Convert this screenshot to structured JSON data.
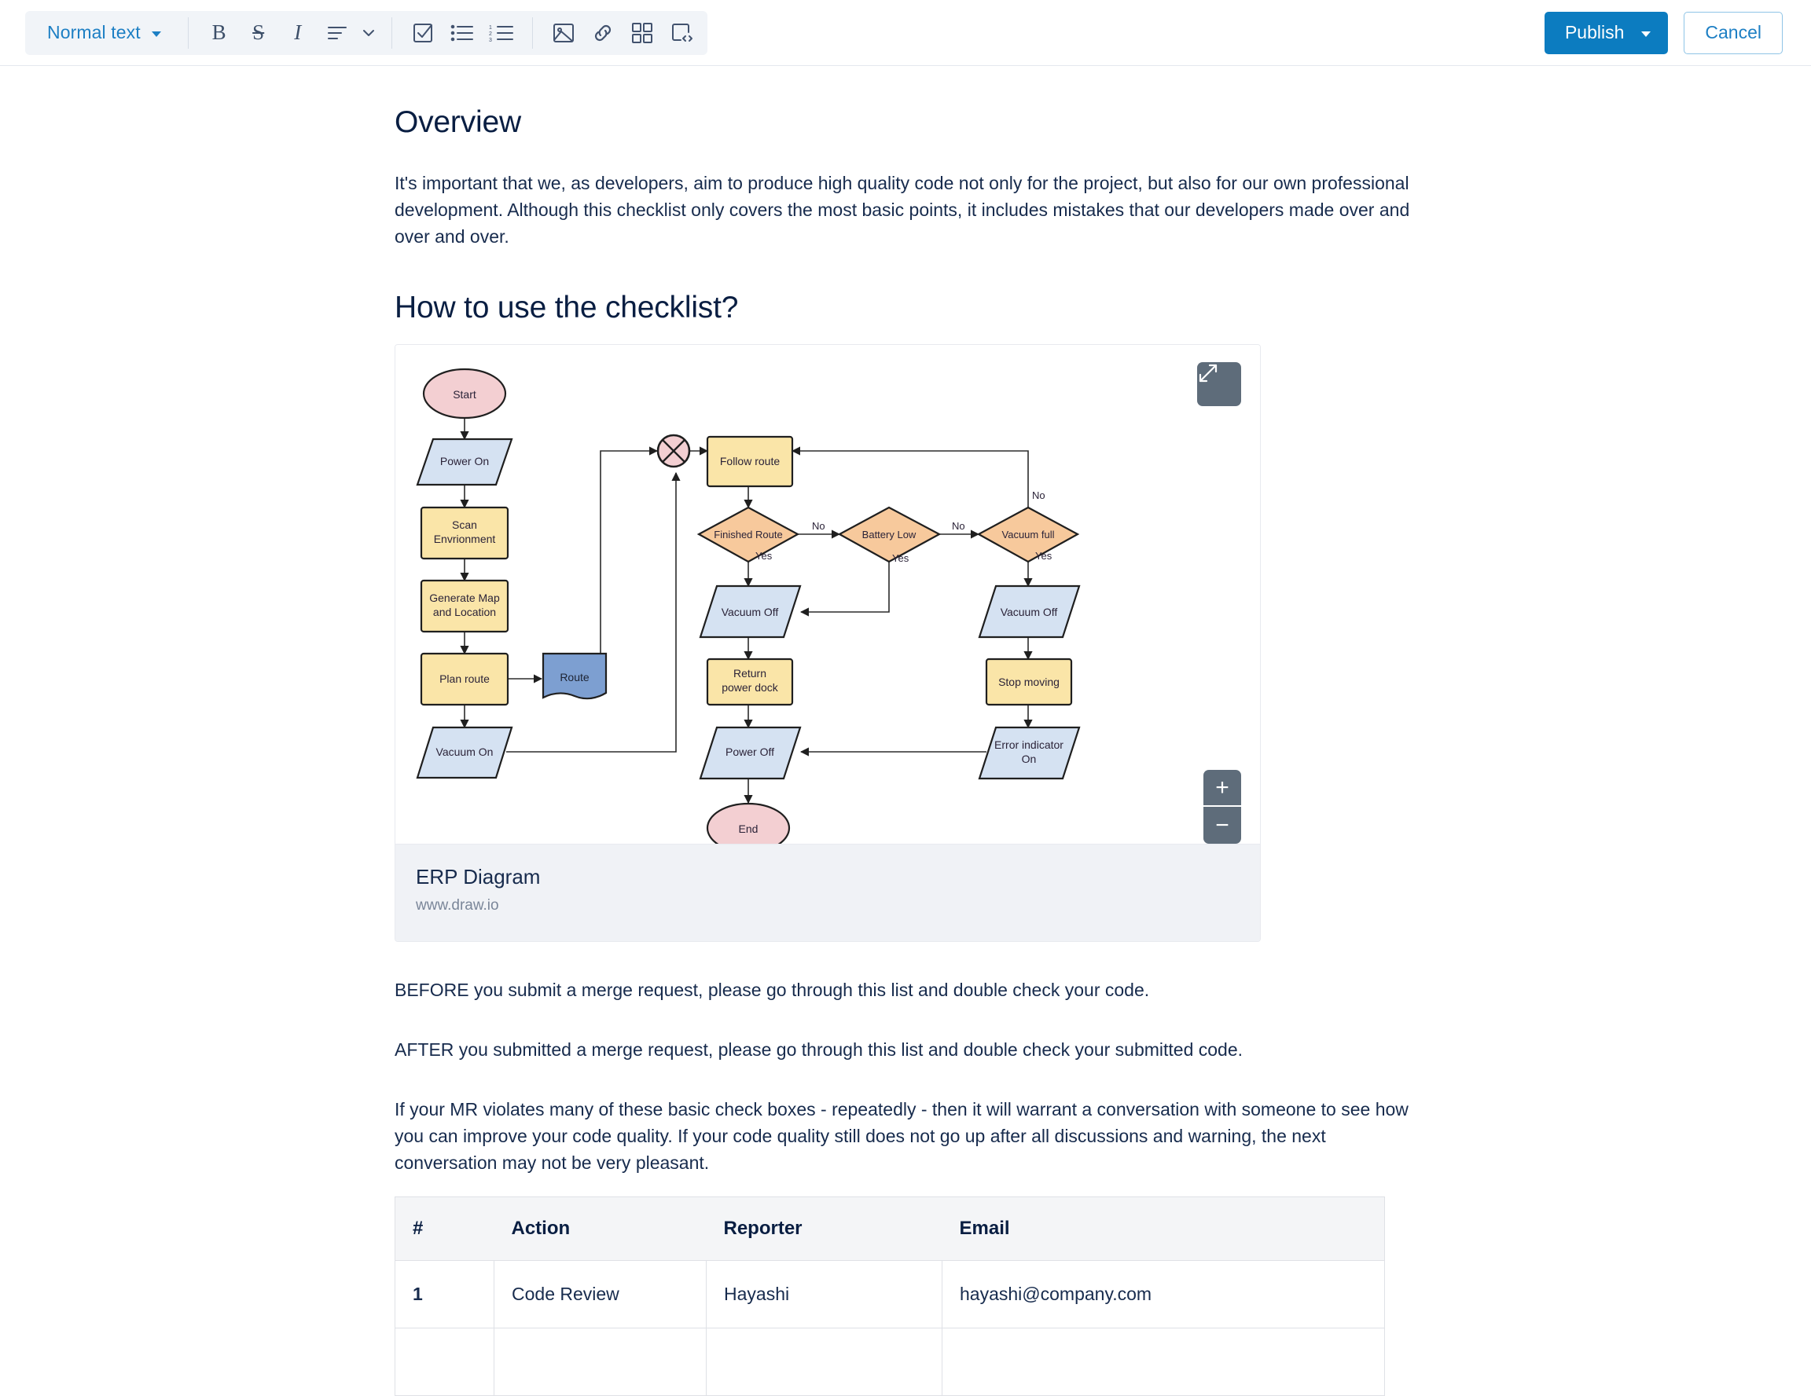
{
  "toolbar": {
    "style_selector": {
      "label": "Normal text",
      "icon": "chevron-down-icon"
    },
    "format_buttons": [
      {
        "name": "bold-button",
        "glyph": "B"
      },
      {
        "name": "strikethrough-button",
        "glyph": "S"
      },
      {
        "name": "italic-button",
        "glyph": "I"
      }
    ],
    "align_button": "align-left-icon",
    "align_chevron": "chevron-down-icon",
    "list_buttons": [
      "task-list-icon",
      "bullet-list-icon",
      "numbered-list-icon"
    ],
    "insert_buttons": [
      "image-icon",
      "link-icon",
      "table-icon",
      "code-block-icon"
    ],
    "publish_label": "Publish",
    "publish_chevron": "chevron-down-icon",
    "cancel_label": "Cancel"
  },
  "document": {
    "heading_overview": "Overview",
    "paragraph_overview": "It's important that we, as developers, aim to produce high quality code not only for the project, but also for our own professional development. Although this checklist only covers the most basic points, it includes mistakes that our developers made over and over and over.",
    "heading_howto": "How to use the checklist?",
    "paragraph_before": "BEFORE you submit a merge request, please go through this list and double check your code.",
    "paragraph_after": "AFTER you submitted a merge request, please go through this list and double check your submitted code.",
    "paragraph_violates": "If your MR violates many of these basic check boxes - repeatedly - then it will warrant a conversation with someone to see how you can improve your code quality. If your code quality still does not go up after all discussions and warning, the next conversation may not be very pleasant."
  },
  "diagram": {
    "caption_title": "ERP Diagram",
    "caption_subtitle": "www.draw.io",
    "expand_icon": "expand-icon",
    "zoom_in_label": "+",
    "zoom_out_label": "−",
    "colors": {
      "terminator_fill": "#f3cfd2",
      "io_fill": "#d5e2f2",
      "process_fill": "#fae5a8",
      "decision_fill": "#f7c99c",
      "document_fill": "#7d9fd1",
      "stroke": "#1f1f1f"
    },
    "nodes": [
      {
        "id": "start",
        "label": "Start",
        "shape": "ellipse"
      },
      {
        "id": "power-on",
        "label": "Power On",
        "shape": "parallelogram"
      },
      {
        "id": "scan",
        "label_line1": "Scan",
        "label_line2": "Envrionment",
        "shape": "process"
      },
      {
        "id": "genmap",
        "label_line1": "Generate Map",
        "label_line2": "and Location",
        "shape": "process"
      },
      {
        "id": "planroute",
        "label": "Plan route",
        "shape": "process"
      },
      {
        "id": "route",
        "label": "Route",
        "shape": "document"
      },
      {
        "id": "vacuum-on",
        "label": "Vacuum On",
        "shape": "parallelogram"
      },
      {
        "id": "merge",
        "label": "",
        "shape": "summing-junction"
      },
      {
        "id": "follow",
        "label": "Follow route",
        "shape": "process"
      },
      {
        "id": "finished",
        "label": "Finished Route",
        "shape": "decision"
      },
      {
        "id": "battery",
        "label": "Battery Low",
        "shape": "decision"
      },
      {
        "id": "vacfull",
        "label": "Vacuum full",
        "shape": "decision"
      },
      {
        "id": "vacoff1",
        "label": "Vacuum Off",
        "shape": "parallelogram"
      },
      {
        "id": "vacoff2",
        "label": "Vacuum Off",
        "shape": "parallelogram"
      },
      {
        "id": "returndock",
        "label_line1": "Return",
        "label_line2": "power dock",
        "shape": "process"
      },
      {
        "id": "stopmoving",
        "label": "Stop moving",
        "shape": "process"
      },
      {
        "id": "poweroff",
        "label": "Power Off",
        "shape": "parallelogram"
      },
      {
        "id": "errorind",
        "label_line1": "Error indicator",
        "label_line2": "On",
        "shape": "parallelogram"
      },
      {
        "id": "end",
        "label": "End",
        "shape": "ellipse"
      }
    ],
    "edge_labels": {
      "finished_no": "No",
      "finished_yes": "Yes",
      "battery_no": "No",
      "battery_yes": "Yes",
      "vacfull_no": "No",
      "vacfull_yes": "Yes"
    }
  },
  "table": {
    "headers": [
      "#",
      "Action",
      "Reporter",
      "Email"
    ],
    "rows": [
      {
        "n": "1",
        "action": "Code Review",
        "reporter": "Hayashi",
        "email": "hayashi@company.com"
      }
    ]
  }
}
